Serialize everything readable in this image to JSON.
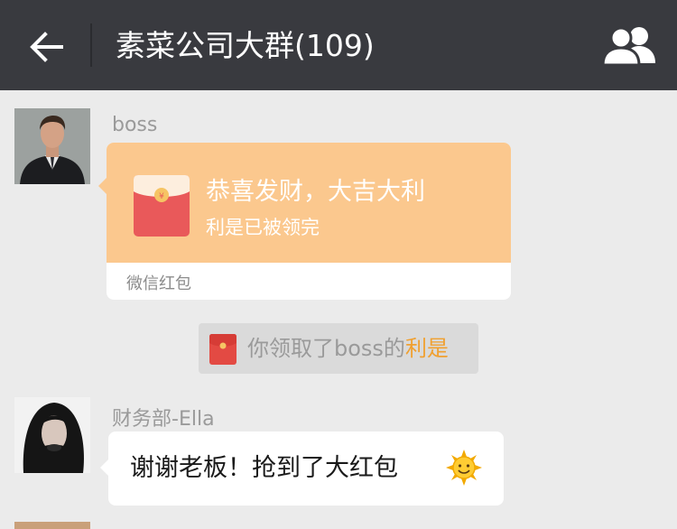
{
  "header": {
    "title": "素菜公司大群(109)",
    "back_icon": "arrow-left-icon",
    "members_icon": "group-members-icon"
  },
  "messages": [
    {
      "sender": "boss",
      "avatar": "man-in-suit-avatar",
      "type": "red-packet",
      "greeting": "恭喜发财，大吉大利",
      "status": "利是已被领完",
      "source": "微信红包"
    },
    {
      "type": "system-notice",
      "icon": "red-packet-icon",
      "text_prefix": "你领取了boss的",
      "link_text": "利是"
    },
    {
      "sender": "财务部-Ella",
      "avatar": "woman-dark-hair-avatar",
      "type": "text",
      "text": "谢谢老板！抢到了大红包",
      "emoji": "sun-smile-emoji"
    }
  ],
  "colors": {
    "header_bg": "#393a3f",
    "chat_bg": "#ebebeb",
    "packet_orange": "#fbc88e",
    "link_orange": "#f0a030"
  }
}
